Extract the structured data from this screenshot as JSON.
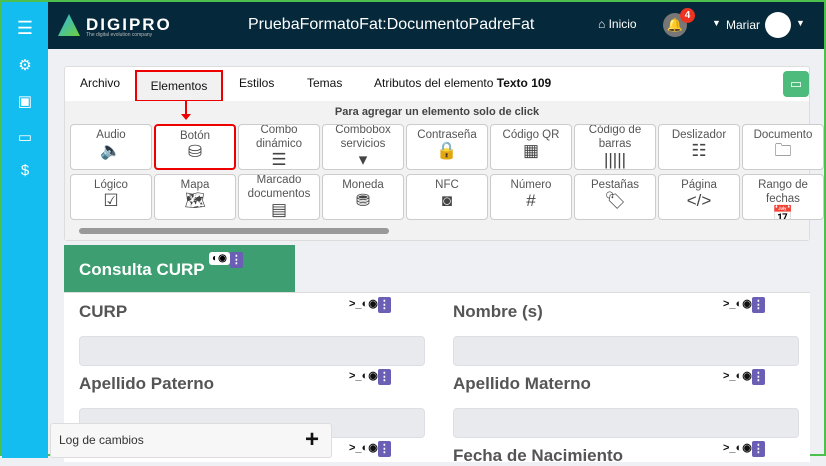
{
  "header": {
    "brand": "DIGIPRO",
    "tagline": "The digital evolution company",
    "title": "PruebaFormatoFat:DocumentoPadreFat",
    "home": "Inicio",
    "notifications": "4",
    "user": "Mariar"
  },
  "tabs": [
    "Archivo",
    "Elementos",
    "Estilos",
    "Temas"
  ],
  "attr_tab": {
    "prefix": "Atributos del elemento ",
    "element": "Texto 109"
  },
  "palette": {
    "hint": "Para agregar un elemento solo de click",
    "items": [
      {
        "label": "Audio",
        "icon": "file-audio-icon",
        "glyph": "🔈"
      },
      {
        "label": "Botón",
        "icon": "database-icon",
        "glyph": "⛁"
      },
      {
        "label": "Combo dinámico",
        "icon": "list-grid-icon",
        "glyph": "☰"
      },
      {
        "label": "Combobox servicios",
        "icon": "caret-square-icon",
        "glyph": "▾"
      },
      {
        "label": "Contraseña",
        "icon": "lock-icon",
        "glyph": "🔒"
      },
      {
        "label": "Código QR",
        "icon": "qrcode-icon",
        "glyph": "▦"
      },
      {
        "label": "Código de barras",
        "icon": "barcode-icon",
        "glyph": "|||||"
      },
      {
        "label": "Deslizador",
        "icon": "sliders-icon",
        "glyph": "☷"
      },
      {
        "label": "Documento",
        "icon": "folder-icon",
        "glyph": "🗀"
      },
      {
        "label": "Lógico",
        "icon": "checkbox-icon",
        "glyph": "☑"
      },
      {
        "label": "Mapa",
        "icon": "map-icon",
        "glyph": "🗺"
      },
      {
        "label": "Marcado documentos",
        "icon": "list-alt-icon",
        "glyph": "▤"
      },
      {
        "label": "Moneda",
        "icon": "coins-icon",
        "glyph": "⛃"
      },
      {
        "label": "NFC",
        "icon": "nfc-icon",
        "glyph": "◙"
      },
      {
        "label": "Número",
        "icon": "hashtag-icon",
        "glyph": "#"
      },
      {
        "label": "Pestañas",
        "icon": "tags-icon",
        "glyph": "🏷"
      },
      {
        "label": "Página",
        "icon": "file-code-icon",
        "glyph": "</>"
      },
      {
        "label": "Rango de fechas",
        "icon": "calendar-icon",
        "glyph": "📅"
      }
    ]
  },
  "section": {
    "title": "Consulta CURP"
  },
  "fields": [
    "CURP",
    "Nombre (s)",
    "Apellido Paterno",
    "Apellido Materno",
    "",
    "Fecha de Nacimiento"
  ],
  "log": {
    "label": "Log de cambios",
    "add": "+"
  }
}
